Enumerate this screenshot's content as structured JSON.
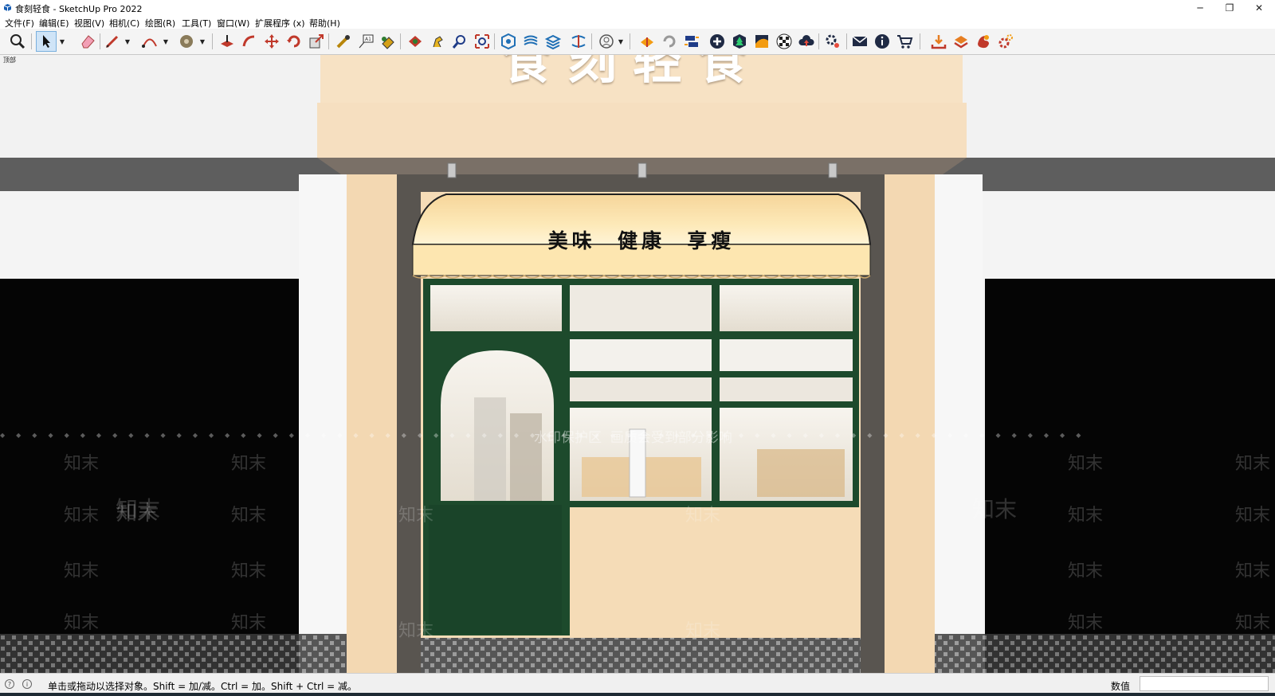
{
  "window": {
    "title": "食刻轻食 - SketchUp Pro 2022",
    "controls": {
      "minimize": "─",
      "restore": "❐",
      "close": "✕"
    }
  },
  "menu": [
    {
      "label": "文件(F)"
    },
    {
      "label": "编辑(E)"
    },
    {
      "label": "视图(V)"
    },
    {
      "label": "相机(C)"
    },
    {
      "label": "绘图(R)"
    },
    {
      "label": "工具(T)"
    },
    {
      "label": "窗口(W)"
    },
    {
      "label": "扩展程序 (x)"
    },
    {
      "label": "帮助(H)"
    }
  ],
  "toolbar": {
    "active_tool": "select",
    "tools": [
      "zoom-extents-icon",
      "select-arrow-icon",
      "eraser-icon",
      "pencil-line-icon",
      "arc-icon",
      "paint-bucket-icon",
      "push-pull-icon",
      "follow-me-icon",
      "move-icon",
      "rotate-icon",
      "scale-icon",
      "tape-measure-icon",
      "text-label-icon",
      "paint-icon",
      "section-plane-icon",
      "walk-icon",
      "zoom-icon",
      "zoom-window-icon",
      "sandbox-icon",
      "3d-warehouse-icon",
      "extension-manager-icon",
      "user-icon",
      "render-icon",
      "orbit-icon",
      "flip-icon",
      "add-icon",
      "tree-icon",
      "terrain-icon",
      "checker-icon",
      "cloud-upload-icon",
      "settings-icon",
      "mail-icon",
      "info-icon",
      "cart-icon",
      "import-icon",
      "layer-icon",
      "fire-icon",
      "gear-icon"
    ]
  },
  "viewport": {
    "scene_label": "顶部",
    "storefront_sign": "美味  健康  享瘦",
    "top_sign_partial": "食刻轻食",
    "watermark_brand": "知末",
    "watermark_notice": "水印保护区  画质会受到部分影响",
    "colors": {
      "facade": "#f5dcb7",
      "awning": "#fde9b8",
      "frame_green": "#1d4a2c",
      "wall_gray": "#5e5e5e",
      "side_white": "#f4f4f4",
      "black_panel": "#050505"
    }
  },
  "status": {
    "hint": "单击或拖动以选择对象。Shift = 加/减。Ctrl = 加。Shift + Ctrl = 减。",
    "vcb_label": "数值",
    "vcb_value": ""
  }
}
